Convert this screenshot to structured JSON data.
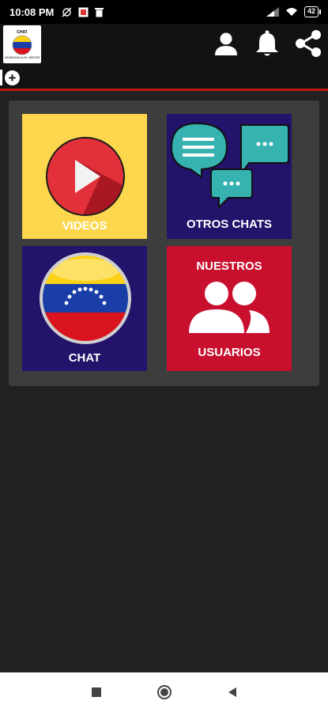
{
  "status_bar": {
    "time": "10:08 PM",
    "battery": "42"
  },
  "app_bar": {
    "logo": {
      "title": "CHAT",
      "subtitle": "VENEZUELA EL MEJOR"
    },
    "icons": [
      "person-icon",
      "bell-icon",
      "share-icon"
    ]
  },
  "tabs": {
    "add_icon": "plus-icon"
  },
  "tiles": [
    {
      "id": "videos",
      "label": "VIDEOS",
      "bg": "#fcd64c",
      "icon": "play-icon"
    },
    {
      "id": "otros_chats",
      "label": "OTROS CHATS",
      "bg": "#23136b",
      "icon": "chat-bubbles-icon"
    },
    {
      "id": "chat",
      "label": "CHAT",
      "bg": "#23136b",
      "icon": "venezuela-flag-icon"
    },
    {
      "id": "usuarios",
      "label_top": "NUESTROS",
      "label_bottom": "USUARIOS",
      "bg": "#c8102e",
      "icon": "group-icon"
    }
  ],
  "nav_bar": {
    "icons": [
      "recent-apps-icon",
      "home-icon",
      "back-icon"
    ]
  },
  "colors": {
    "accent": "#c01818",
    "panel": "#3d3d3d",
    "background": "#212121"
  }
}
